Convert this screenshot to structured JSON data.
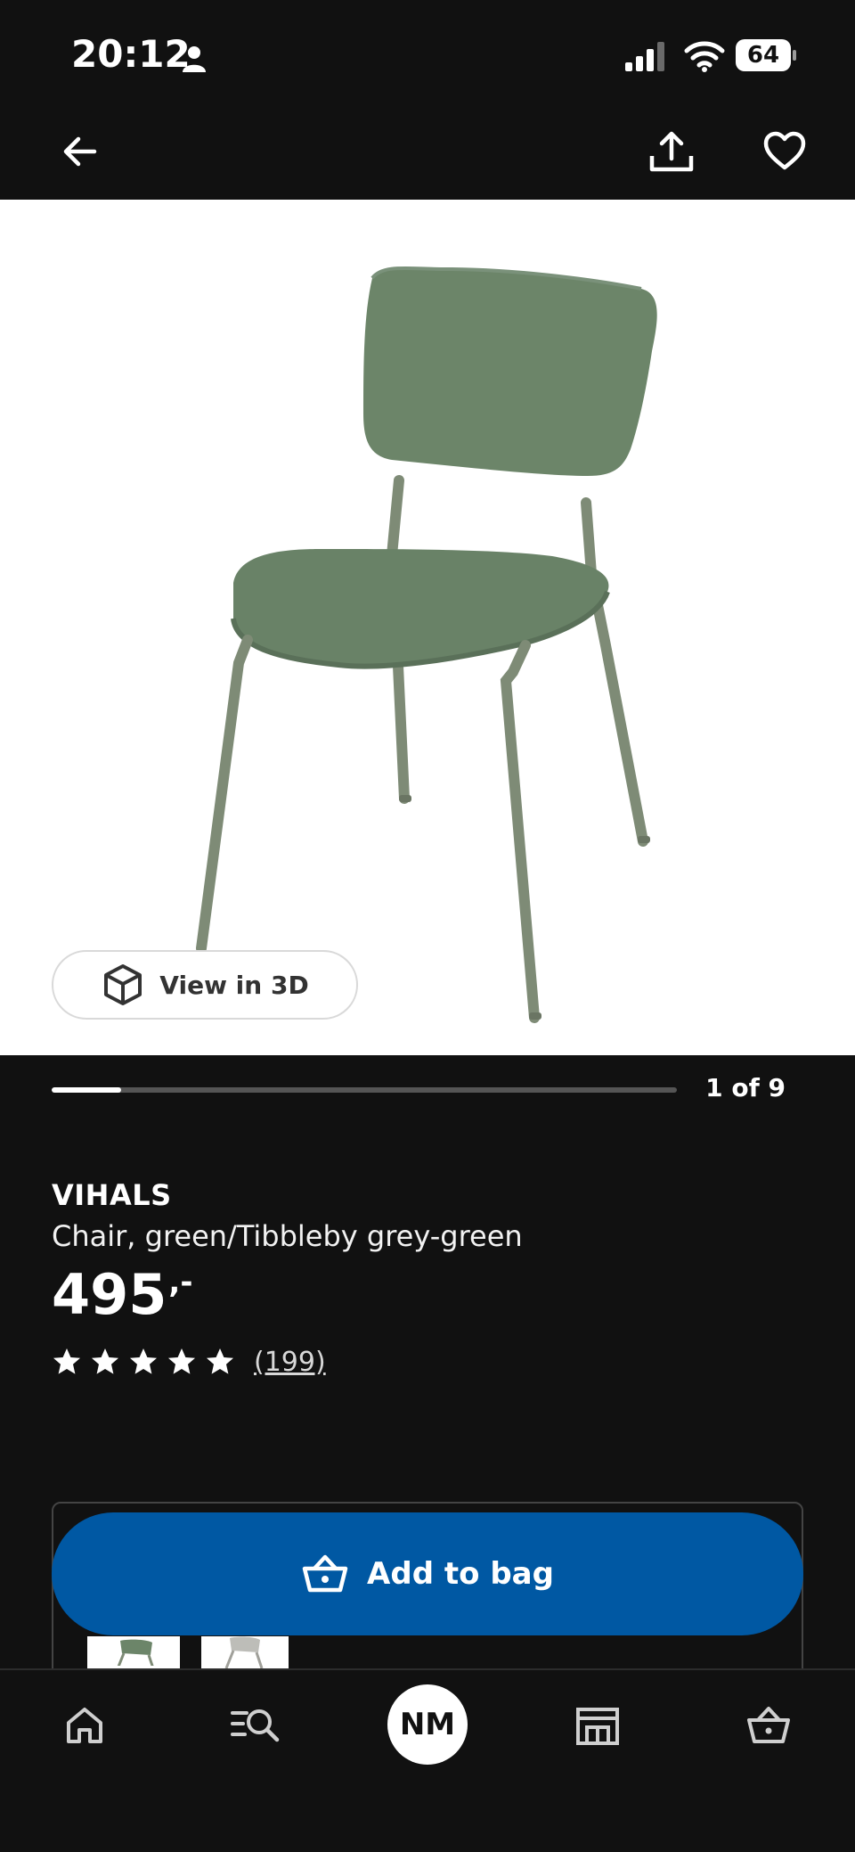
{
  "status_bar": {
    "time": "20:12",
    "battery": "64",
    "icons": [
      "person-icon",
      "signal-icon",
      "wifi-icon",
      "battery-icon"
    ]
  },
  "top_nav": {
    "icons": [
      "back-arrow-icon",
      "share-icon",
      "heart-icon"
    ]
  },
  "product_image": {
    "view_3d_label": "View in 3D",
    "view_3d_icon": "cube-icon"
  },
  "gallery": {
    "counter": "1 of 9",
    "progress_fraction": 0.111
  },
  "product": {
    "name": "VIHALS",
    "description": "Chair, green/Tibbleby grey-green",
    "price_main": "495",
    "price_suffix": ",-",
    "rating_stars": 5,
    "review_count": "(199)"
  },
  "actions": {
    "add_to_bag_label": "Add to bag",
    "add_to_bag_icon": "basket-icon",
    "brand_color": "#0058a3"
  },
  "tab_bar": {
    "items": [
      {
        "name": "home",
        "icon": "home-icon"
      },
      {
        "name": "search",
        "icon": "search-list-icon"
      },
      {
        "name": "profile",
        "label": "NM"
      },
      {
        "name": "store",
        "icon": "store-icon"
      },
      {
        "name": "bag",
        "icon": "basket-icon"
      }
    ]
  },
  "colors": {
    "background": "#111111",
    "chair_green": "#6b8468",
    "chair_frame": "#7f8d78"
  }
}
